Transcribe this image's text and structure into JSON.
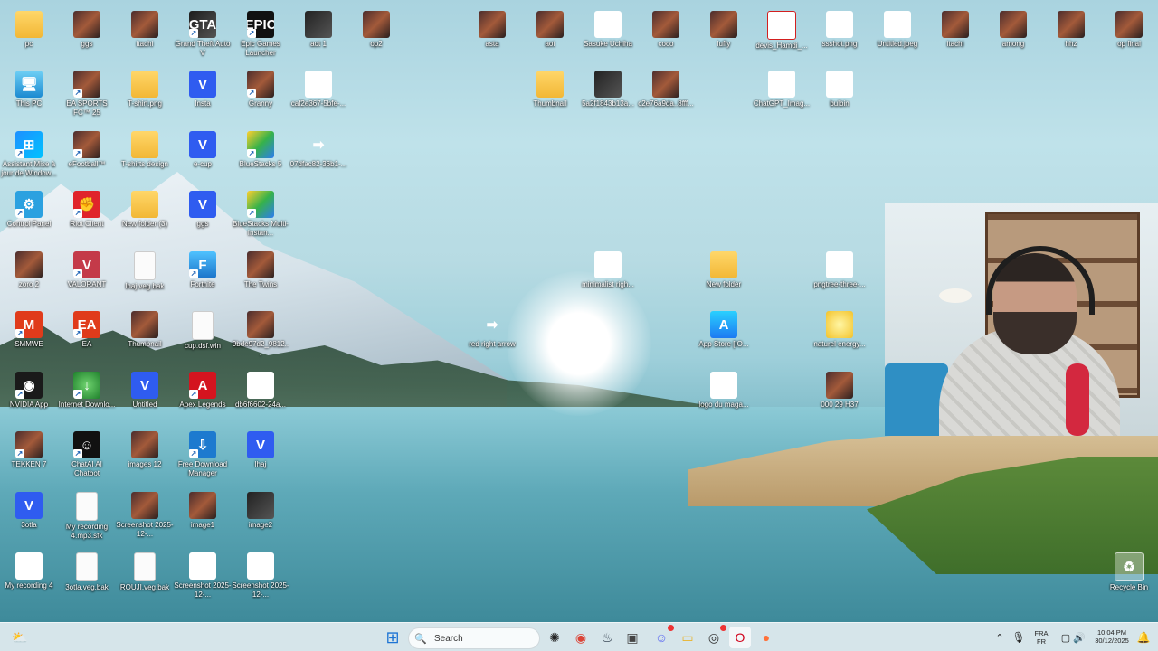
{
  "desktop_icons": [
    {
      "label": "pc",
      "glyph": "",
      "icon": "folder-icon",
      "cls": "g-folder",
      "sc": false
    },
    {
      "label": "This PC",
      "glyph": "🖥",
      "icon": "this-pc-icon",
      "cls": "g-pc",
      "sc": false
    },
    {
      "label": "Assistant Mise à jour de Window...",
      "glyph": "⊞",
      "icon": "windows-logo-icon",
      "cls": "g-win",
      "sc": true
    },
    {
      "label": "Control Panel",
      "glyph": "⚙",
      "icon": "control-panel-icon",
      "cls": "g-blue",
      "sc": true
    },
    {
      "label": "zoro 2",
      "glyph": "",
      "icon": "image-thumbnail-icon",
      "cls": "g-photo",
      "sc": false
    },
    {
      "label": "SMMWE",
      "glyph": "M",
      "icon": "game-icon",
      "cls": "g-ea",
      "sc": true
    },
    {
      "label": "NVIDIA App",
      "glyph": "◉",
      "icon": "nvidia-icon",
      "cls": "g-nvidia",
      "sc": true
    },
    {
      "label": "TEKKEN 7",
      "glyph": "",
      "icon": "game-cover-icon",
      "cls": "g-photo",
      "sc": true
    },
    {
      "label": "3otla",
      "glyph": "V",
      "icon": "vegas-project-icon",
      "cls": "g-v",
      "sc": false
    },
    {
      "label": "My recording 4",
      "glyph": "MP3",
      "icon": "mp3-file-icon",
      "cls": "g-mp3",
      "sc": false
    },
    {
      "label": "ggs",
      "glyph": "",
      "icon": "image-thumbnail-icon",
      "cls": "g-photo",
      "sc": false
    },
    {
      "label": "EA SPORTS FC™ 25",
      "glyph": "",
      "icon": "game-cover-icon",
      "cls": "g-photo",
      "sc": true
    },
    {
      "label": "eFootball™",
      "glyph": "",
      "icon": "game-cover-icon",
      "cls": "g-photo",
      "sc": true
    },
    {
      "label": "Riot Client",
      "glyph": "✊",
      "icon": "riot-client-icon",
      "cls": "g-riot",
      "sc": true
    },
    {
      "label": "VALORANT",
      "glyph": "V",
      "icon": "valorant-icon",
      "cls": "g-valo",
      "sc": true
    },
    {
      "label": "EA",
      "glyph": "EA",
      "icon": "ea-icon",
      "cls": "g-ea",
      "sc": true
    },
    {
      "label": "Internet Downlo...",
      "glyph": "↓",
      "icon": "internet-download-manager-icon",
      "cls": "g-ie",
      "sc": true
    },
    {
      "label": "ChatAI AI Chatbot",
      "glyph": "☺",
      "icon": "chatbot-icon",
      "cls": "g-chatai",
      "sc": true
    },
    {
      "label": "My recording 4.mp3.sfk",
      "glyph": "",
      "icon": "blank-file-icon",
      "cls": "g-doc",
      "sc": false
    },
    {
      "label": "3otla.veg.bak",
      "glyph": "",
      "icon": "blank-file-icon",
      "cls": "g-doc",
      "sc": false
    },
    {
      "label": "itachi",
      "glyph": "",
      "icon": "image-thumbnail-icon",
      "cls": "g-photo",
      "sc": false
    },
    {
      "label": "T-shirt.png",
      "glyph": "",
      "icon": "image-folder-icon",
      "cls": "g-folder",
      "sc": false
    },
    {
      "label": "T-shirts design",
      "glyph": "",
      "icon": "folder-icon",
      "cls": "g-folder",
      "sc": false
    },
    {
      "label": "New folder (3)",
      "glyph": "",
      "icon": "folder-icon",
      "cls": "g-folder",
      "sc": false
    },
    {
      "label": "lhaj.veg.bak",
      "glyph": "",
      "icon": "blank-file-icon",
      "cls": "g-doc",
      "sc": false
    },
    {
      "label": "Thumbnail",
      "glyph": "",
      "icon": "image-thumbnail-icon",
      "cls": "g-photo",
      "sc": false
    },
    {
      "label": "Untitled",
      "glyph": "V",
      "icon": "vegas-project-icon",
      "cls": "g-v",
      "sc": false
    },
    {
      "label": "images 12",
      "glyph": "",
      "icon": "image-thumbnail-icon",
      "cls": "g-photo",
      "sc": false
    },
    {
      "label": "Screenshot 2025-12-...",
      "glyph": "",
      "icon": "image-thumbnail-icon",
      "cls": "g-photo",
      "sc": false
    },
    {
      "label": "ROUJI.veg.bak",
      "glyph": "",
      "icon": "blank-file-icon",
      "cls": "g-doc",
      "sc": false
    },
    {
      "label": "Grand Theft Auto V",
      "glyph": "GTA",
      "icon": "gta-icon",
      "cls": "g-gta",
      "sc": true
    },
    {
      "label": "Insta",
      "glyph": "V",
      "icon": "vegas-project-icon",
      "cls": "g-v",
      "sc": false
    },
    {
      "label": "e-cup",
      "glyph": "V",
      "icon": "vegas-project-icon",
      "cls": "g-v",
      "sc": false
    },
    {
      "label": "ggs",
      "glyph": "V",
      "icon": "vegas-project-icon",
      "cls": "g-v",
      "sc": false
    },
    {
      "label": "Fortnite",
      "glyph": "F",
      "icon": "fortnite-icon",
      "cls": "g-fortnite",
      "sc": true
    },
    {
      "label": "cup.dsf.win",
      "glyph": "",
      "icon": "blank-file-icon",
      "cls": "g-doc",
      "sc": false
    },
    {
      "label": "Apex Legends",
      "glyph": "A",
      "icon": "apex-legends-icon",
      "cls": "g-apex",
      "sc": true
    },
    {
      "label": "Free Download Manager",
      "glyph": "⇩",
      "icon": "free-download-manager-icon",
      "cls": "g-fdm",
      "sc": true
    },
    {
      "label": "image1",
      "glyph": "",
      "icon": "image-thumbnail-icon",
      "cls": "g-photo",
      "sc": false
    },
    {
      "label": "Screenshot 2025-12-...",
      "glyph": "▶",
      "icon": "google-play-icon",
      "cls": "g-gplay",
      "sc": false
    },
    {
      "label": "Epic Games Launcher",
      "glyph": "EPIC",
      "icon": "epic-games-icon",
      "cls": "g-epic",
      "sc": true
    },
    {
      "label": "Granny",
      "glyph": "",
      "icon": "game-cover-icon",
      "cls": "g-photo",
      "sc": true
    },
    {
      "label": "BlueStacks 5",
      "glyph": "",
      "icon": "bluestacks-icon",
      "cls": "g-bluestacks",
      "sc": true
    },
    {
      "label": "BlueStacks Multi-Instan...",
      "glyph": "",
      "icon": "bluestacks-multi-icon",
      "cls": "g-bluestacks",
      "sc": true
    },
    {
      "label": "The Twins",
      "glyph": "",
      "icon": "image-thumbnail-icon",
      "cls": "g-photo",
      "sc": false
    },
    {
      "label": "9bde97d2_9812...",
      "glyph": "",
      "icon": "image-thumbnail-icon",
      "cls": "g-photo",
      "sc": false
    },
    {
      "label": "db6f6602-24a...",
      "glyph": "▶",
      "icon": "google-play-icon",
      "cls": "g-gplay",
      "sc": false
    },
    {
      "label": "lhaj",
      "glyph": "V",
      "icon": "vegas-project-icon",
      "cls": "g-v",
      "sc": false
    },
    {
      "label": "image2",
      "glyph": "",
      "icon": "image-thumbnail-icon",
      "cls": "g-dark",
      "sc": false
    },
    {
      "label": "Screenshot 2025-12-...",
      "glyph": "↗",
      "icon": "arrow-image-icon",
      "cls": "g-arrow",
      "sc": false
    },
    {
      "label": "aot 1",
      "glyph": "",
      "icon": "image-thumbnail-icon",
      "cls": "g-dark",
      "sc": false
    },
    {
      "label": "caf2e367-5bfe-...",
      "glyph": "↗",
      "icon": "arrow-image-icon",
      "cls": "g-arrow",
      "sc": false
    },
    {
      "label": "07dfac82-36b1-...",
      "glyph": "➡",
      "icon": "red-arrow-icon",
      "cls": "g-redarrow",
      "sc": false
    },
    {
      "label": "op2",
      "glyph": "",
      "icon": "image-thumbnail-icon",
      "cls": "g-photo",
      "sc": false
    },
    {
      "label": "asta",
      "glyph": "",
      "icon": "image-thumbnail-icon",
      "cls": "g-photo",
      "sc": false
    },
    {
      "label": "Thumbnail",
      "glyph": "",
      "icon": "folder-icon",
      "cls": "g-folder",
      "sc": false
    },
    {
      "label": "red right arrow",
      "glyph": "➡",
      "icon": "red-arrow-icon",
      "cls": "g-redarrow",
      "sc": false
    },
    {
      "label": "aot",
      "glyph": "",
      "icon": "image-thumbnail-icon",
      "cls": "g-photo",
      "sc": false
    },
    {
      "label": "Sasuke Uchiha",
      "glyph": "",
      "icon": "image-thumbnail-icon",
      "cls": "g-white",
      "sc": false
    },
    {
      "label": "5a2f1843b13a...",
      "glyph": "",
      "icon": "image-thumbnail-icon",
      "cls": "g-dark",
      "sc": false
    },
    {
      "label": "minimalist righ...",
      "glyph": "↗",
      "icon": "arrow-image-icon",
      "cls": "g-arrow",
      "sc": false
    },
    {
      "label": "c2e76a9da..8fff...",
      "glyph": "",
      "icon": "image-thumbnail-icon",
      "cls": "g-photo",
      "sc": false
    },
    {
      "label": "coco",
      "glyph": "",
      "icon": "image-thumbnail-icon",
      "cls": "g-photo",
      "sc": false
    },
    {
      "label": "luffy",
      "glyph": "",
      "icon": "image-thumbnail-icon",
      "cls": "g-photo",
      "sc": false
    },
    {
      "label": "New folder",
      "glyph": "",
      "icon": "folder-icon",
      "cls": "g-folder",
      "sc": false
    },
    {
      "label": "App Store [IO...",
      "glyph": "A",
      "icon": "app-store-icon",
      "cls": "g-appstore",
      "sc": false
    },
    {
      "label": "logo du maga...",
      "glyph": "▶",
      "icon": "google-play-icon",
      "cls": "g-gplay",
      "sc": false
    },
    {
      "label": "devis_Hamdi_...",
      "glyph": "PDF",
      "icon": "pdf-file-icon",
      "cls": "g-pdf",
      "sc": false
    },
    {
      "label": "ChatGPT_Imag...",
      "glyph": "",
      "icon": "image-thumbnail-icon",
      "cls": "g-white",
      "sc": false
    },
    {
      "label": "ssshot.png",
      "glyph": "●",
      "icon": "image-file-icon",
      "cls": "g-white",
      "sc": false
    },
    {
      "label": "bulbin",
      "glyph": "",
      "icon": "image-thumbnail-icon",
      "cls": "g-white",
      "sc": false
    },
    {
      "label": "pngtree-three-...",
      "glyph": "",
      "icon": "image-thumbnail-icon",
      "cls": "g-white",
      "sc": false
    },
    {
      "label": "naturel energy...",
      "glyph": "",
      "icon": "image-thumbnail-icon",
      "cls": "g-gold",
      "sc": false
    },
    {
      "label": "000 29 H37",
      "glyph": "",
      "icon": "image-thumbnail-icon",
      "cls": "g-photo",
      "sc": false
    },
    {
      "label": "Untitled.jpeg",
      "glyph": "●",
      "icon": "image-file-icon",
      "cls": "g-white",
      "sc": false
    },
    {
      "label": "itachi",
      "glyph": "",
      "icon": "image-thumbnail-icon",
      "cls": "g-photo",
      "sc": false
    },
    {
      "label": "among",
      "glyph": "",
      "icon": "image-thumbnail-icon",
      "cls": "g-photo",
      "sc": false
    },
    {
      "label": "hhz",
      "glyph": "",
      "icon": "image-thumbnail-icon",
      "cls": "g-photo",
      "sc": false
    },
    {
      "label": "op final",
      "glyph": "",
      "icon": "image-thumbnail-icon",
      "cls": "g-photo",
      "sc": false
    },
    {
      "label": "Recycle Bin",
      "glyph": "♻",
      "icon": "recycle-bin-icon",
      "cls": "g-recycle",
      "sc": false
    }
  ],
  "taskbar": {
    "search_label": "Search",
    "language_line1": "FRA",
    "language_line2": "FR",
    "time": "10:04 PM",
    "date": "30/12/2025"
  }
}
